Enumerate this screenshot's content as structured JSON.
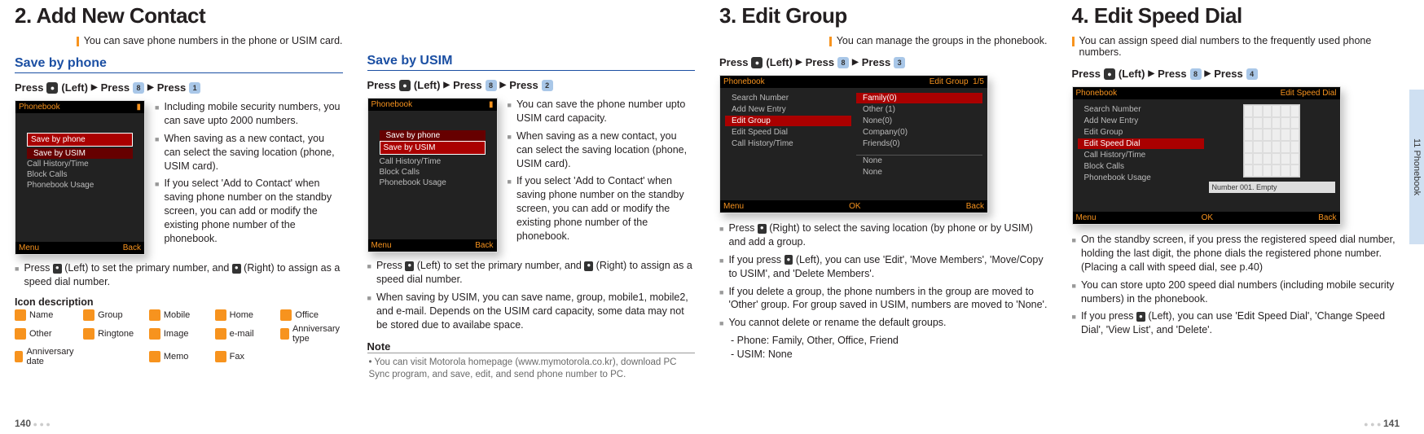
{
  "sideTab": "11 Phonebook",
  "pageLeft": "140",
  "pageRight": "141",
  "sec2": {
    "title": "2. Add New Contact",
    "sub": "You can save phone numbers in the phone or USIM card.",
    "byPhone": "Save by phone",
    "byUSIM": "Save by USIM",
    "pressA": "Press",
    "pressB": "(Left)",
    "pressC": "Press",
    "pressD": "Press",
    "key1": "●",
    "key2a": "8",
    "key2b": "1",
    "key2c": "2",
    "shotA": {
      "hdL": "Phonebook",
      "red1": "Save by phone",
      "line2": "Save by USIM",
      "m1": "Call History/Time",
      "m2": "Block Calls",
      "m3": "Phonebook Usage",
      "sL": "Menu",
      "sR": "Back"
    },
    "bp1": "Including mobile security numbers, you can save upto 2000 numbers.",
    "bp2": "When saving as a new contact, you can select the saving location (phone, USIM card).",
    "bp3": "If you select 'Add to Contact' when saving phone number on the standby screen, you can add or modify the existing phone number of the phonebook.",
    "bp4a": "Press ",
    "bp4b": " (Left) to set the primary number, and ",
    "bp4c": " (Right) to assign as a speed dial number.",
    "iconTitle": "Icon description",
    "icons": {
      "name": "Name",
      "group": "Group",
      "mobile": "Mobile",
      "home": "Home",
      "office": "Office",
      "other": "Other",
      "ringtone": "Ringtone",
      "image": "Image",
      "email": "e-mail",
      "annivType": "Anniversary type",
      "annivDate": "Anniversary date",
      "memo": "Memo",
      "fax": "Fax"
    },
    "bu1": "You can save the phone number upto USIM card capacity.",
    "bu2": "When saving as a new contact, you can select the saving location (phone, USIM card).",
    "bu3": "If you select 'Add to Contact' when saving phone number on the standby screen, you can add or modify the existing phone number of the phonebook.",
    "bu4a": "Press ",
    "bu4b": " (Left) to set the primary number, and ",
    "bu4c": " (Right) to assign as a speed dial number.",
    "bu5": "When saving by USIM, you can save name, group, mobile1, mobile2, and e-mail. Depends on the USIM card capacity, some data may not be stored due to availabe space.",
    "noteLabel": "Note",
    "noteBody": "You can visit Motorola homepage (www.mymotorola.co.kr), download PC Sync program, and save, edit, and send phone number to PC."
  },
  "sec3": {
    "title": "3. Edit Group",
    "sub": "You can manage the groups in the phonebook.",
    "key3": "3",
    "shot": {
      "hdL": "Phonebook",
      "hdR": "Edit Group",
      "count": "1/5",
      "lL1": "Search Number",
      "lL2": "Add New Entry",
      "lL3": "Edit Group",
      "lL4": "Edit Speed Dial",
      "lL5": "Call History/Time",
      "rL1": "Family(0)",
      "rL2": "Other (1)",
      "rL3": "None(0)",
      "rL4": "Company(0)",
      "rL5": "Friends(0)",
      "rB1": "None",
      "rB2": "None",
      "sL": "Menu",
      "sM": "OK",
      "sR": "Back"
    },
    "b1a": "Press ",
    "b1b": " (Right) to select the saving location (by phone or by USIM) and add a group.",
    "b2a": "If you press ",
    "b2b": " (Left), you can use 'Edit', 'Move Members', 'Move/Copy to USIM', and 'Delete Members'.",
    "b3": "If you delete a group, the phone numbers in the group are moved to 'Other' group. For group saved in USIM, numbers are moved to 'None'.",
    "b4": "You cannot delete or rename the default groups.",
    "b4a": "- Phone: Family, Other, Office, Friend",
    "b4b": "- USIM: None"
  },
  "sec4": {
    "title": "4. Edit Speed Dial",
    "sub": "You can assign speed dial numbers to the frequently used phone numbers.",
    "key4": "4",
    "shot": {
      "hdL": "Phonebook",
      "hdR": "Edit Speed Dial",
      "lL1": "Search Number",
      "lL2": "Add New Entry",
      "lL3": "Edit Group",
      "lL4": "Edit Speed Dial",
      "lL5": "Call History/Time",
      "lL6": "Block Calls",
      "lL7": "Phonebook Usage",
      "inp": "Number 001. Empty",
      "sL": "Menu",
      "sM": "OK",
      "sR": "Back"
    },
    "b1": "On the standby screen, if you press the registered speed dial number, holding the last digit, the phone dials the registered phone number. (Placing a call with speed dial, see p.40)",
    "b2": "You can store upto 200 speed dial numbers (including mobile security numbers) in the phonebook.",
    "b3a": "If you press ",
    "b3b": " (Left), you can use 'Edit Speed Dial', 'Change Speed Dial', 'View List', and 'Delete'."
  }
}
